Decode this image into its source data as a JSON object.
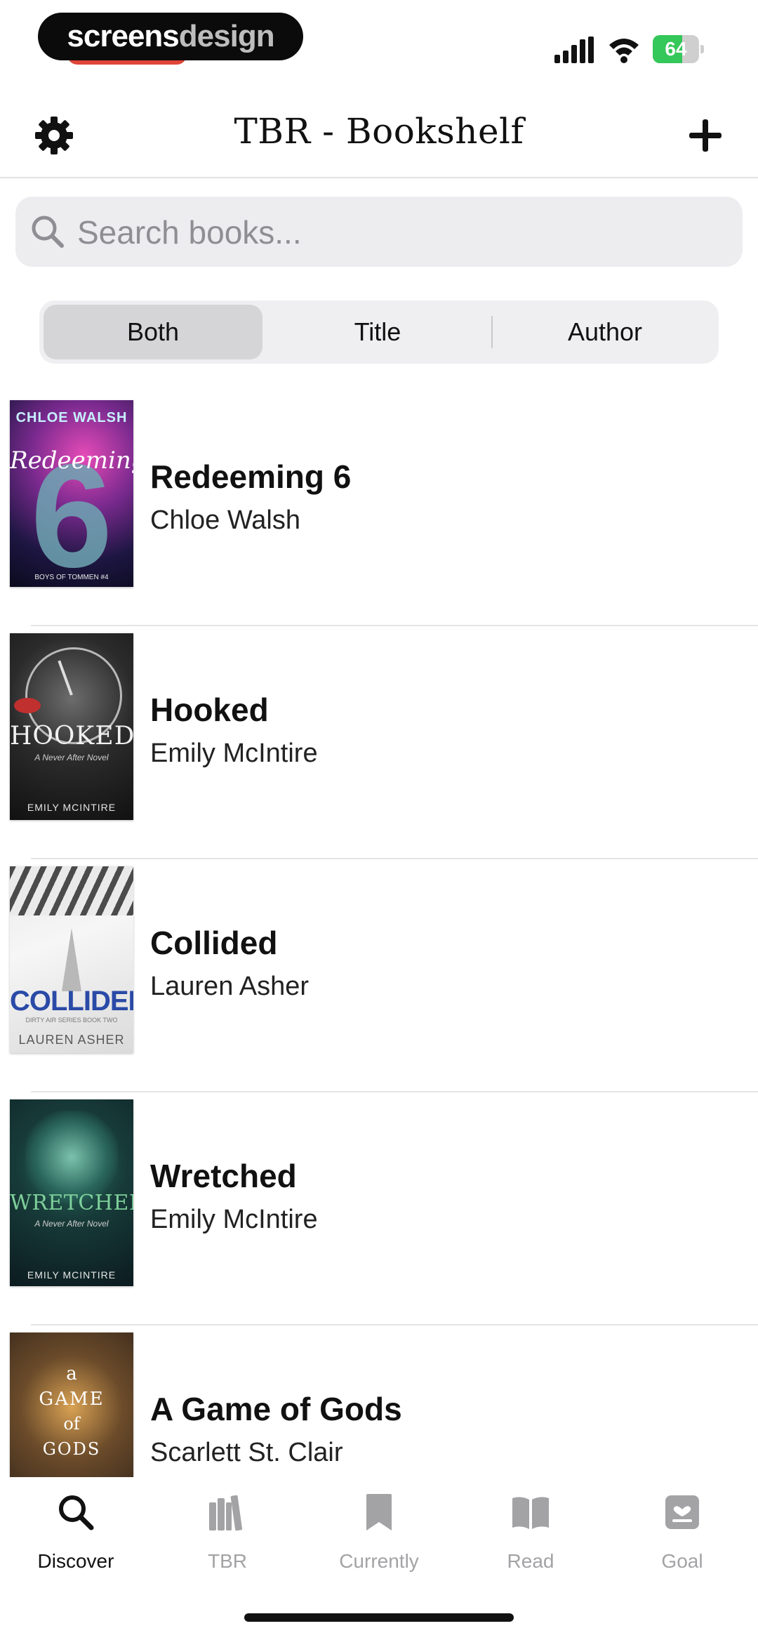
{
  "status_bar": {
    "brand_part1": "screens",
    "brand_part2": "design",
    "battery_level": 64,
    "battery_text": "64"
  },
  "header": {
    "title": "TBR - Bookshelf"
  },
  "search": {
    "placeholder": "Search books..."
  },
  "segment": {
    "options": [
      "Both",
      "Title",
      "Author"
    ],
    "selected": "Both"
  },
  "books": [
    {
      "title": "Redeeming 6",
      "author": "Chloe Walsh",
      "cover": {
        "top": "CHLOE WALSH",
        "script": "Redeeming",
        "number": "6",
        "bottom": "BOYS OF TOMMEN #4"
      }
    },
    {
      "title": "Hooked",
      "author": "Emily McIntire",
      "cover": {
        "main": "HOOKED",
        "sub": "A Never After Novel",
        "bottom": "EMILY MCINTIRE"
      }
    },
    {
      "title": "Collided",
      "author": "Lauren Asher",
      "cover": {
        "main": "COLLIDED",
        "sub": "DIRTY AIR SERIES BOOK TWO",
        "bottom": "LAUREN ASHER"
      }
    },
    {
      "title": "Wretched",
      "author": "Emily McIntire",
      "cover": {
        "main": "WRETCHED",
        "sub": "A Never After Novel",
        "bottom": "EMILY MCINTIRE"
      }
    },
    {
      "title": "A Game of Gods",
      "author": "Scarlett St. Clair",
      "cover": {
        "line1": "a",
        "line2": "GAME",
        "line3": "of",
        "line4": "GODS"
      }
    }
  ],
  "tabs": [
    {
      "label": "Discover",
      "icon": "search-icon",
      "active": true
    },
    {
      "label": "TBR",
      "icon": "books-icon",
      "active": false
    },
    {
      "label": "Currently",
      "icon": "bookmark-icon",
      "active": false
    },
    {
      "label": "Read",
      "icon": "open-book-icon",
      "active": false
    },
    {
      "label": "Goal",
      "icon": "goal-card-icon",
      "active": false
    }
  ],
  "colors": {
    "battery_green": "#34c759",
    "inactive_tab": "#a3a3a6",
    "brand_red": "#e0453a"
  }
}
